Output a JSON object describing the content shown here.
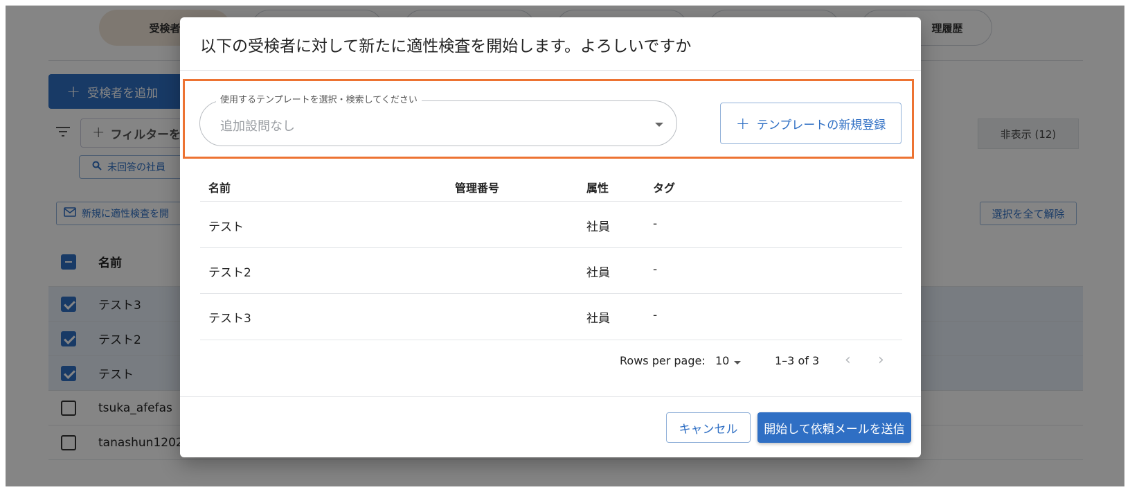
{
  "background": {
    "tabs": [
      "受検者",
      "",
      "",
      "",
      "",
      "",
      "理履歴"
    ],
    "add_button": "受検者を追加",
    "filter_placeholder": "フィルターを",
    "unanswered_chip": "未回答の社員",
    "hidden_tab": "非表示 (12)",
    "bulk_start_button": "新規に適性検査を開",
    "clear_selection_button": "選択を全て解除",
    "table_header_name": "名前",
    "rows": [
      {
        "name": "テスト3",
        "selected": true
      },
      {
        "name": "テスト2",
        "selected": true
      },
      {
        "name": "テスト",
        "selected": true
      },
      {
        "name": "tsuka_afefas",
        "selected": false
      },
      {
        "name": "tanashun1202",
        "selected": false
      }
    ]
  },
  "dialog": {
    "title": "以下の受検者に対して新たに適性検査を開始します。よろしいですか",
    "template_select": {
      "label": "使用するテンプレートを選択・検索してください",
      "value": "追加設問なし"
    },
    "new_template_button": "テンプレートの新規登録",
    "table": {
      "headers": {
        "name": "名前",
        "id": "管理番号",
        "attribute": "属性",
        "tags": "タグ"
      },
      "rows": [
        {
          "name": "テスト",
          "id": "",
          "attribute": "社員",
          "tags": "-"
        },
        {
          "name": "テスト2",
          "id": "",
          "attribute": "社員",
          "tags": "-"
        },
        {
          "name": "テスト3",
          "id": "",
          "attribute": "社員",
          "tags": "-"
        }
      ]
    },
    "pagination": {
      "rows_per_page_label": "Rows per page:",
      "rows_per_page": "10",
      "range": "1–3 of 3"
    },
    "cancel_button": "キャンセル",
    "send_button": "開始して依頼メールを送信"
  },
  "colors": {
    "primary": "#2f6fc4",
    "highlight": "#ed7332",
    "active_tab": "#f1e6d8"
  }
}
